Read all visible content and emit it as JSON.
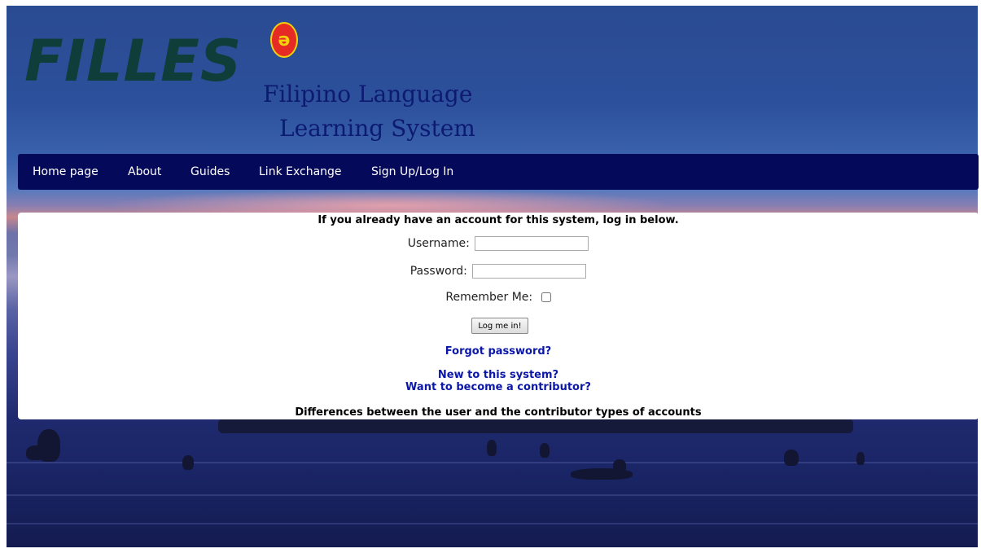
{
  "brand": {
    "logo_text": "FILLES",
    "badge_glyph": "ə",
    "subtitle_line1": "Filipino Language",
    "subtitle_line2": "Learning System"
  },
  "nav": {
    "items": [
      "Home page",
      "About",
      "Guides",
      "Link Exchange",
      "Sign Up/Log In"
    ]
  },
  "login": {
    "intro": "If you already have an account for this system, log in below.",
    "username_label": "Username:",
    "username_value": "",
    "password_label": "Password:",
    "password_value": "",
    "remember_label": "Remember Me:",
    "remember_checked": false,
    "submit_label": "Log me in!",
    "forgot_link": "Forgot password?",
    "new_link": "New to this system?",
    "contributor_link": "Want to become a contributor?",
    "differences_text": "Differences between the user and the contributor types of accounts"
  },
  "colors": {
    "nav_bg": "#05095a",
    "link": "#0b17a8",
    "logo": "#0f3d3a",
    "subtitle": "#0d1a72"
  }
}
